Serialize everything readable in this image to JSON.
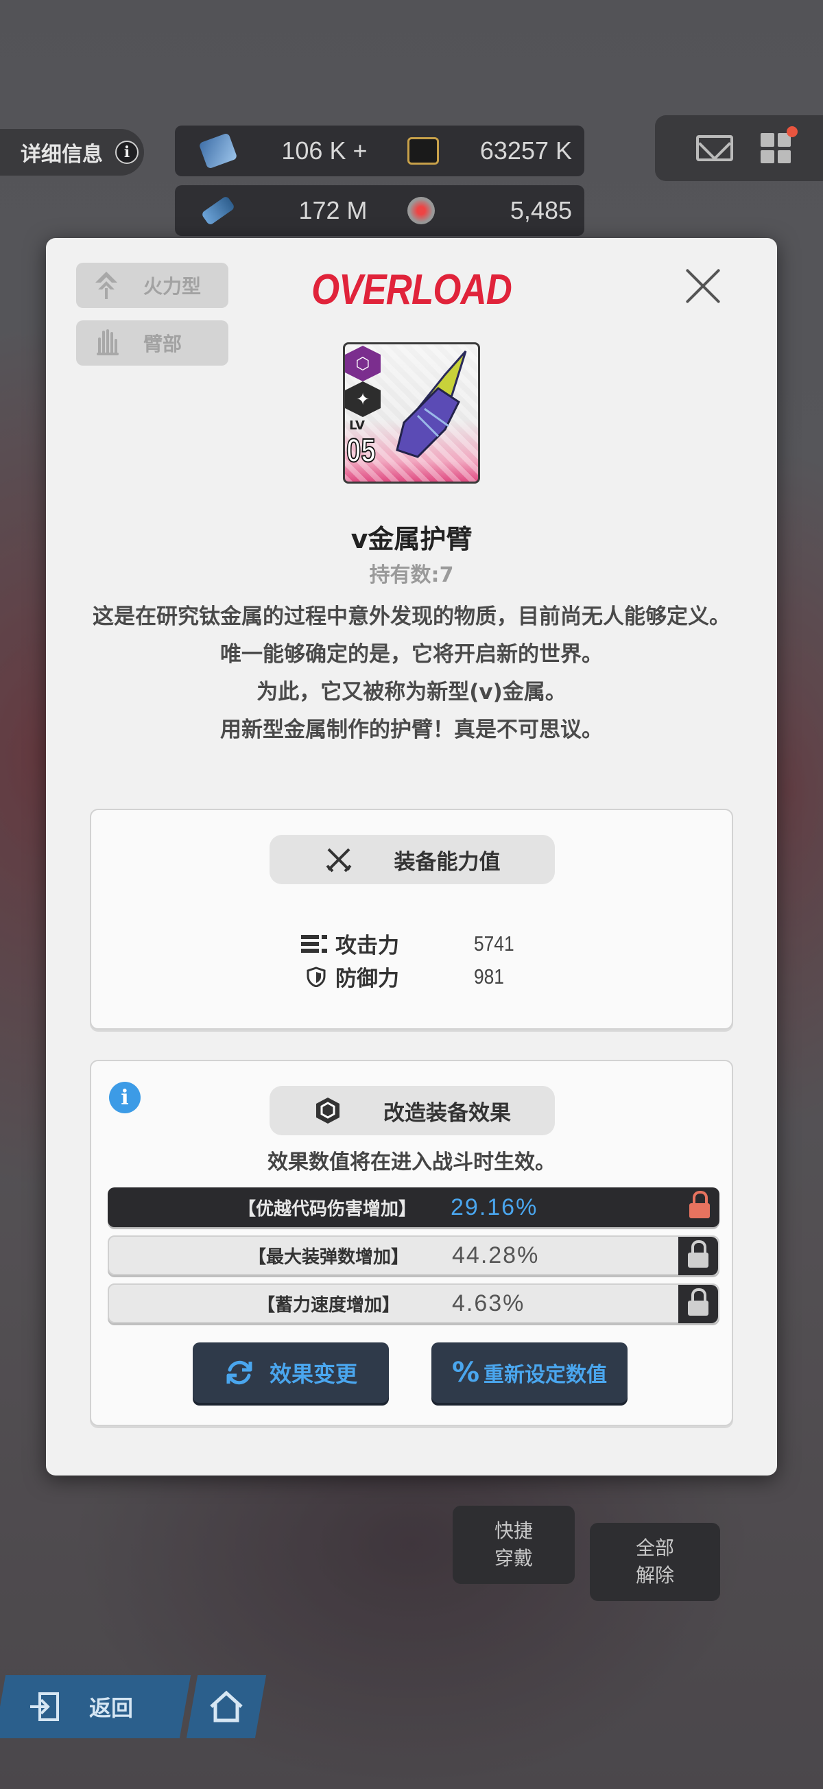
{
  "topbar": {
    "detail_label": "详细信息",
    "resources": [
      {
        "icon": "gem-icon",
        "value": "106 K",
        "plus": "+"
      },
      {
        "icon": "card-icon",
        "value": "63257 K"
      },
      {
        "icon": "battery-icon",
        "value": "172 M"
      },
      {
        "icon": "core-icon",
        "value": "5,485"
      }
    ]
  },
  "modal": {
    "tags": [
      {
        "icon": "firepower-icon",
        "label": "火力型"
      },
      {
        "icon": "arm-icon",
        "label": "臂部"
      }
    ],
    "brand": "OVERLOAD",
    "item": {
      "level_label": "LV",
      "level": "05",
      "name": "v金属护臂",
      "owned_label": "持有数:",
      "owned_count": "7"
    },
    "description": [
      "这是在研究钛金属的过程中意外发现的物质，目前尚无人能够定义。",
      "唯一能够确定的是，它将开启新的世界。",
      "为此，它又被称为新型(v)金属。",
      "用新型金属制作的护臂！真是不可思议。"
    ],
    "stats_panel": {
      "title": "装备能力值",
      "stats": [
        {
          "label": "攻击力",
          "value": "5741"
        },
        {
          "label": "防御力",
          "value": "981"
        }
      ]
    },
    "effects_panel": {
      "title": "改造装备效果",
      "note": "效果数值将在进入战斗时生效。",
      "effects": [
        {
          "name": "【优越代码伤害增加】",
          "value": "29.16%",
          "locked": true
        },
        {
          "name": "【最大装弹数增加】",
          "value": "44.28%",
          "locked": false
        },
        {
          "name": "【蓄力速度增加】",
          "value": "4.63%",
          "locked": false
        }
      ],
      "change_button": "效果变更",
      "reset_button": "重新设定数值"
    }
  },
  "bottom": {
    "quick_equip": "快捷\n穿戴",
    "unequip_all": "全部\n解除",
    "back": "返回"
  },
  "colors": {
    "brand_red": "#e0233a",
    "accent_blue": "#4aa6ee",
    "lock_red": "#e7735f"
  }
}
